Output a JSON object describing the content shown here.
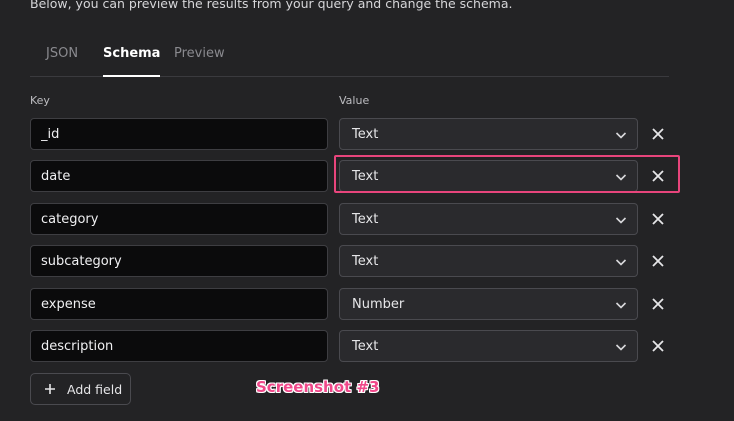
{
  "intro_text": "Below, you can preview the results from your query and change the schema.",
  "tabs": [
    {
      "label": "JSON",
      "active": false
    },
    {
      "label": "Schema",
      "active": true
    },
    {
      "label": "Preview",
      "active": false
    }
  ],
  "columns": {
    "key": "Key",
    "value": "Value"
  },
  "fields": [
    {
      "key": "_id",
      "type": "Text"
    },
    {
      "key": "date",
      "type": "Text"
    },
    {
      "key": "category",
      "type": "Text"
    },
    {
      "key": "subcategory",
      "type": "Text"
    },
    {
      "key": "expense",
      "type": "Number"
    },
    {
      "key": "description",
      "type": "Text"
    }
  ],
  "add_field_label": "Add field",
  "annotation": "Screenshot #3",
  "highlighted_field": "date",
  "icons": {
    "dropdown": "chevron-down-icon",
    "remove": "close-icon",
    "add": "plus-icon"
  },
  "colors": {
    "background": "#232325",
    "highlight": "#e8457c",
    "annotation": "#f0488a"
  }
}
